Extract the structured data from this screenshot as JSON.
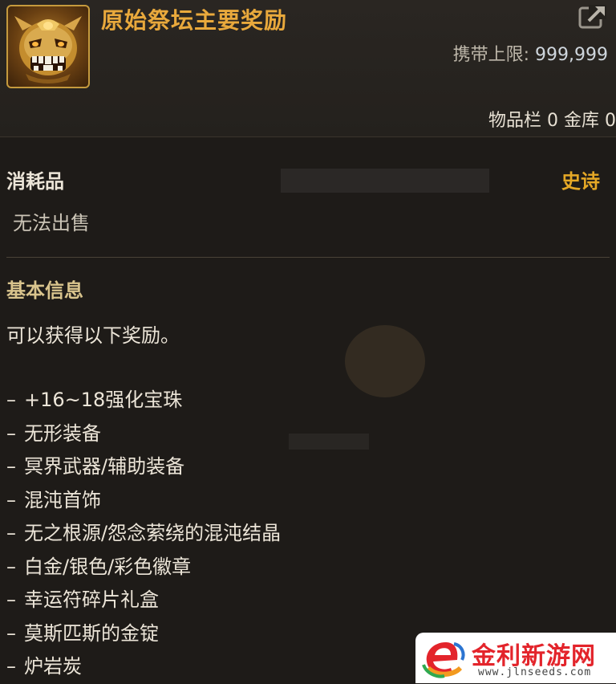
{
  "item": {
    "title": "原始祭坛主要奖励",
    "icon": "golden-demon-mask-icon",
    "carry_limit_label": "携带上限:",
    "carry_limit_value": "999,999",
    "storage": "物品栏 0 金库 0"
  },
  "details": {
    "type": "消耗品",
    "rarity": "史诗",
    "sell_status": "无法出售"
  },
  "basic_info": {
    "title": "基本信息",
    "description": "可以获得以下奖励。",
    "rewards": [
      "+16~18强化宝珠",
      "无形装备",
      "冥界武器/辅助装备",
      "混沌首饰",
      "无之根源/怨念萦绕的混沌结晶",
      "白金/银色/彩色徽章",
      "幸运符碎片礼盒",
      "莫斯匹斯的金锭",
      "炉岩炭"
    ],
    "bullet": "–"
  },
  "watermark": {
    "name": "金利新游网",
    "url": "www.jlnseeds.com"
  },
  "colors": {
    "title": "#e9a93c",
    "rarity": "#e5a826",
    "section_title": "#d9c48d",
    "background": "#1e1b18"
  }
}
